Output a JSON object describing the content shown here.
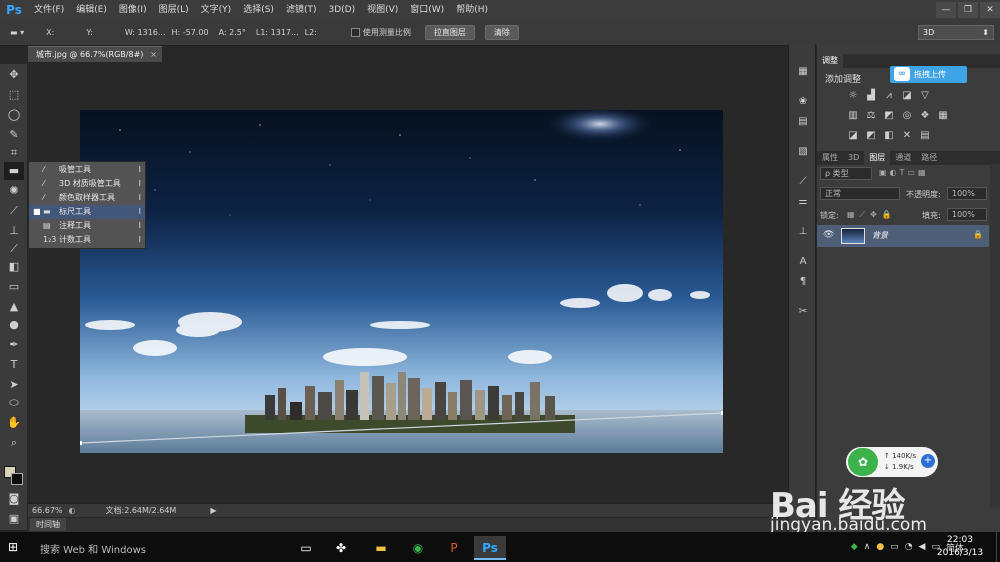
{
  "app": {
    "logo": "Ps",
    "menu": [
      "文件(F)",
      "编辑(E)",
      "图像(I)",
      "图层(L)",
      "文字(Y)",
      "选择(S)",
      "滤镜(T)",
      "3D(D)",
      "视图(V)",
      "窗口(W)",
      "帮助(H)"
    ],
    "window_controls": [
      "—",
      "❐",
      "✕"
    ]
  },
  "options_bar": {
    "tool_preset": "▬ ▾",
    "x_label": "X:",
    "y_label": "Y:",
    "w": "W: 1316...",
    "h": "H: -57.00",
    "angle": "A: 2.5°",
    "l1": "L1: 1317...",
    "l2": "L2:",
    "use_measure_scale": "使用测量比例",
    "straighten_button": "拉直图层",
    "clear_button": "清除",
    "workspace": "3D"
  },
  "document": {
    "tab_title": "城市.jpg @ 66.7%(RGB/8#)",
    "tab_close": "×"
  },
  "tool_flyout": {
    "items": [
      {
        "icon": "⁄",
        "label": "吸管工具",
        "key": "I",
        "active": false
      },
      {
        "icon": "⁄",
        "label": "3D 材质吸管工具",
        "key": "I",
        "active": false
      },
      {
        "icon": "⁄",
        "label": "颜色取样器工具",
        "key": "I",
        "active": false
      },
      {
        "icon": "▬",
        "label": "标尺工具",
        "key": "I",
        "active": true
      },
      {
        "icon": "▤",
        "label": "注释工具",
        "key": "I",
        "active": false
      },
      {
        "icon": "1₂3",
        "label": "计数工具",
        "key": "I",
        "active": false
      }
    ],
    "active_marker": "■"
  },
  "status_bar": {
    "zoom": "66.67%",
    "doc_size": "文档:2.64M/2.64M",
    "arrow": "▶"
  },
  "timeline_tab": "时间轴",
  "right_panel": {
    "adjust_tab": "调整",
    "add_adjustment": "添加调整",
    "upload_button": "拖拽上传",
    "layer_tabs": [
      "属性",
      "3D",
      "图层",
      "通道",
      "路径"
    ],
    "active_layer_tab": "图层",
    "filter_kind": "ρ 类型",
    "blend_mode": "正常",
    "opacity_label": "不透明度:",
    "opacity_value": "100%",
    "lock_label": "锁定:",
    "fill_label": "填充:",
    "fill_value": "100%",
    "layer_name": "背景"
  },
  "net_widget": {
    "upload_speed": "↑  140K/s",
    "download_speed": "↓  1.9K/s",
    "plus": "+"
  },
  "watermark": {
    "main": "Bai 经验",
    "sub": "jingyan.baidu.com"
  },
  "taskbar": {
    "search_placeholder": "搜索 Web 和 Windows",
    "tray_lang": "简体",
    "time": "22:03",
    "date": "2016/3/13"
  },
  "colors": {
    "accent_blue": "#3fa4e6",
    "ps_blue": "#31a8ff",
    "selected_layer": "#4f5e77"
  }
}
